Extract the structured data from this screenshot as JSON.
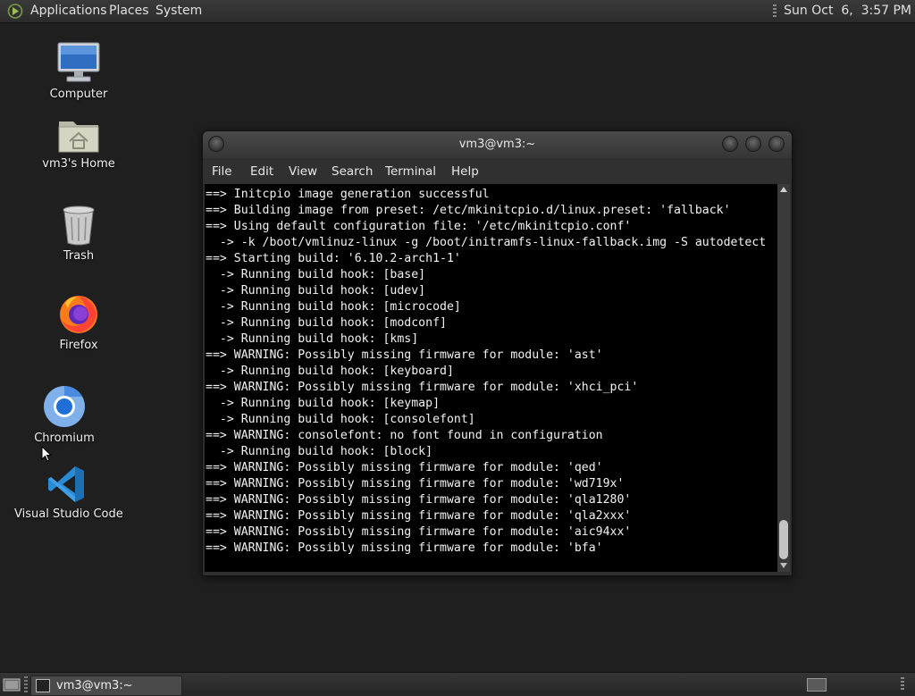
{
  "top_panel": {
    "menus": [
      "Applications",
      "Places",
      "System"
    ],
    "clock": "Sun Oct  6,  3:57 PM"
  },
  "desktop_icons": [
    {
      "label": "Computer",
      "icon": "computer-icon"
    },
    {
      "label": "vm3's Home",
      "icon": "home-folder-icon"
    },
    {
      "label": "Trash",
      "icon": "trash-icon"
    },
    {
      "label": "Firefox",
      "icon": "firefox-icon"
    },
    {
      "label": "Chromium",
      "icon": "chromium-icon"
    },
    {
      "label": "Visual Studio Code",
      "icon": "vscode-icon"
    }
  ],
  "terminal": {
    "title": "vm3@vm3:~",
    "menu": [
      "File",
      "Edit",
      "View",
      "Search",
      "Terminal",
      "Help"
    ],
    "lines": [
      "==> Initcpio image generation successful",
      "==> Building image from preset: /etc/mkinitcpio.d/linux.preset: 'fallback'",
      "==> Using default configuration file: '/etc/mkinitcpio.conf'",
      "  -> -k /boot/vmlinuz-linux -g /boot/initramfs-linux-fallback.img -S autodetect",
      "==> Starting build: '6.10.2-arch1-1'",
      "  -> Running build hook: [base]",
      "  -> Running build hook: [udev]",
      "  -> Running build hook: [microcode]",
      "  -> Running build hook: [modconf]",
      "  -> Running build hook: [kms]",
      "==> WARNING: Possibly missing firmware for module: 'ast'",
      "  -> Running build hook: [keyboard]",
      "==> WARNING: Possibly missing firmware for module: 'xhci_pci'",
      "  -> Running build hook: [keymap]",
      "  -> Running build hook: [consolefont]",
      "==> WARNING: consolefont: no font found in configuration",
      "  -> Running build hook: [block]",
      "==> WARNING: Possibly missing firmware for module: 'qed'",
      "==> WARNING: Possibly missing firmware for module: 'wd719x'",
      "==> WARNING: Possibly missing firmware for module: 'qla1280'",
      "==> WARNING: Possibly missing firmware for module: 'qla2xxx'",
      "==> WARNING: Possibly missing firmware for module: 'aic94xx'",
      "==> WARNING: Possibly missing firmware for module: 'bfa'"
    ]
  },
  "taskbar": {
    "task_label": "vm3@vm3:~"
  },
  "colors": {
    "desktop_bg": "#1f1f1f",
    "panel_bg": "#2b2b2b",
    "terminal_bg": "#000000",
    "terminal_fg": "#f2f2f2"
  }
}
